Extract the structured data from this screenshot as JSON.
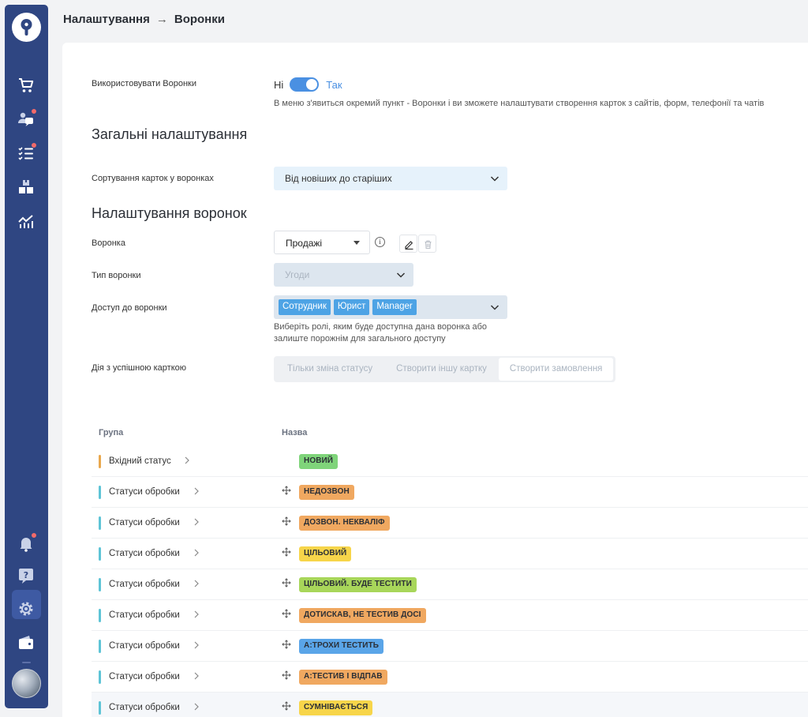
{
  "breadcrumb": {
    "parent": "Налаштування",
    "arrow": "→",
    "current": "Воронки"
  },
  "use_funnels": {
    "label": "Використовувати Воронки",
    "off_label": "Ні",
    "on_label": "Так",
    "enabled": true,
    "hint": "В меню з'явиться окремий пункт - Воронки і ви зможете налаштувати створення карток з сайтів, форм, телефонії та чатів"
  },
  "general": {
    "title": "Загальні налаштування",
    "sort_label": "Сортування карток у воронках",
    "sort_value": "Від новіших до старіших"
  },
  "funnel_settings": {
    "title": "Налаштування воронок",
    "funnel_label": "Воронка",
    "funnel_value": "Продажі",
    "type_label": "Тип воронки",
    "type_value": "Угоди",
    "access_label": "Доступ до воронки",
    "access_tags": [
      "Сотрудник",
      "Юрист",
      "Manager"
    ],
    "access_hint_1": "Виберіть ролі, яким буде доступна дана воронка або",
    "access_hint_2": "залиште порожнім для загального доступу",
    "success_label": "Дія з успішною карткою",
    "success_options": [
      "Тільки зміна статусу",
      "Створити іншу картку",
      "Створити замовлення"
    ],
    "success_selected": "Створити замовлення"
  },
  "table": {
    "col_group": "Група",
    "col_name": "Назва",
    "rows": [
      {
        "group": "Вхідний статус",
        "group_color": "#e9a84e",
        "name": "НОВИЙ",
        "badge_color": "#7fd47a",
        "movable": false
      },
      {
        "group": "Статуси обробки",
        "group_color": "#5ec4d6",
        "name": "НЕДОЗВОН",
        "badge_color": "#f0a860",
        "movable": true
      },
      {
        "group": "Статуси обробки",
        "group_color": "#5ec4d6",
        "name": "ДОЗВОН. НЕКВАЛІФ",
        "badge_color": "#f0a860",
        "movable": true
      },
      {
        "group": "Статуси обробки",
        "group_color": "#5ec4d6",
        "name": "ЦІЛЬОВИЙ",
        "badge_color": "#f7d54a",
        "movable": true
      },
      {
        "group": "Статуси обробки",
        "group_color": "#5ec4d6",
        "name": "ЦІЛЬОВИЙ. БУДЕ ТЕСТИТИ",
        "badge_color": "#a8d65a",
        "movable": true
      },
      {
        "group": "Статуси обробки",
        "group_color": "#5ec4d6",
        "name": "ДОТИСКАВ, НЕ ТЕСТИВ ДОСІ",
        "badge_color": "#f0a860",
        "movable": true
      },
      {
        "group": "Статуси обробки",
        "group_color": "#5ec4d6",
        "name": "А:ТРОХИ ТЕСТИТЬ",
        "badge_color": "#5aa5e8",
        "movable": true
      },
      {
        "group": "Статуси обробки",
        "group_color": "#5ec4d6",
        "name": "А:ТЕСТИВ І ВІДПАВ",
        "badge_color": "#f0a860",
        "movable": true
      },
      {
        "group": "Статуси обробки",
        "group_color": "#5ec4d6",
        "name": "СУМНІВАЄТЬСЯ",
        "badge_color": "#f7d54a",
        "movable": true
      }
    ]
  },
  "colors": {
    "sidebar": "#2f4682",
    "accent": "#4a90e2",
    "tag": "#4da3e5"
  },
  "sidebar_icons": [
    "key-logo-icon",
    "cart-icon",
    "users-chat-icon",
    "task-list-icon",
    "boxes-icon",
    "analytics-icon",
    "bell-icon",
    "help-icon",
    "settings-icon",
    "wallet-icon",
    "avatar"
  ]
}
